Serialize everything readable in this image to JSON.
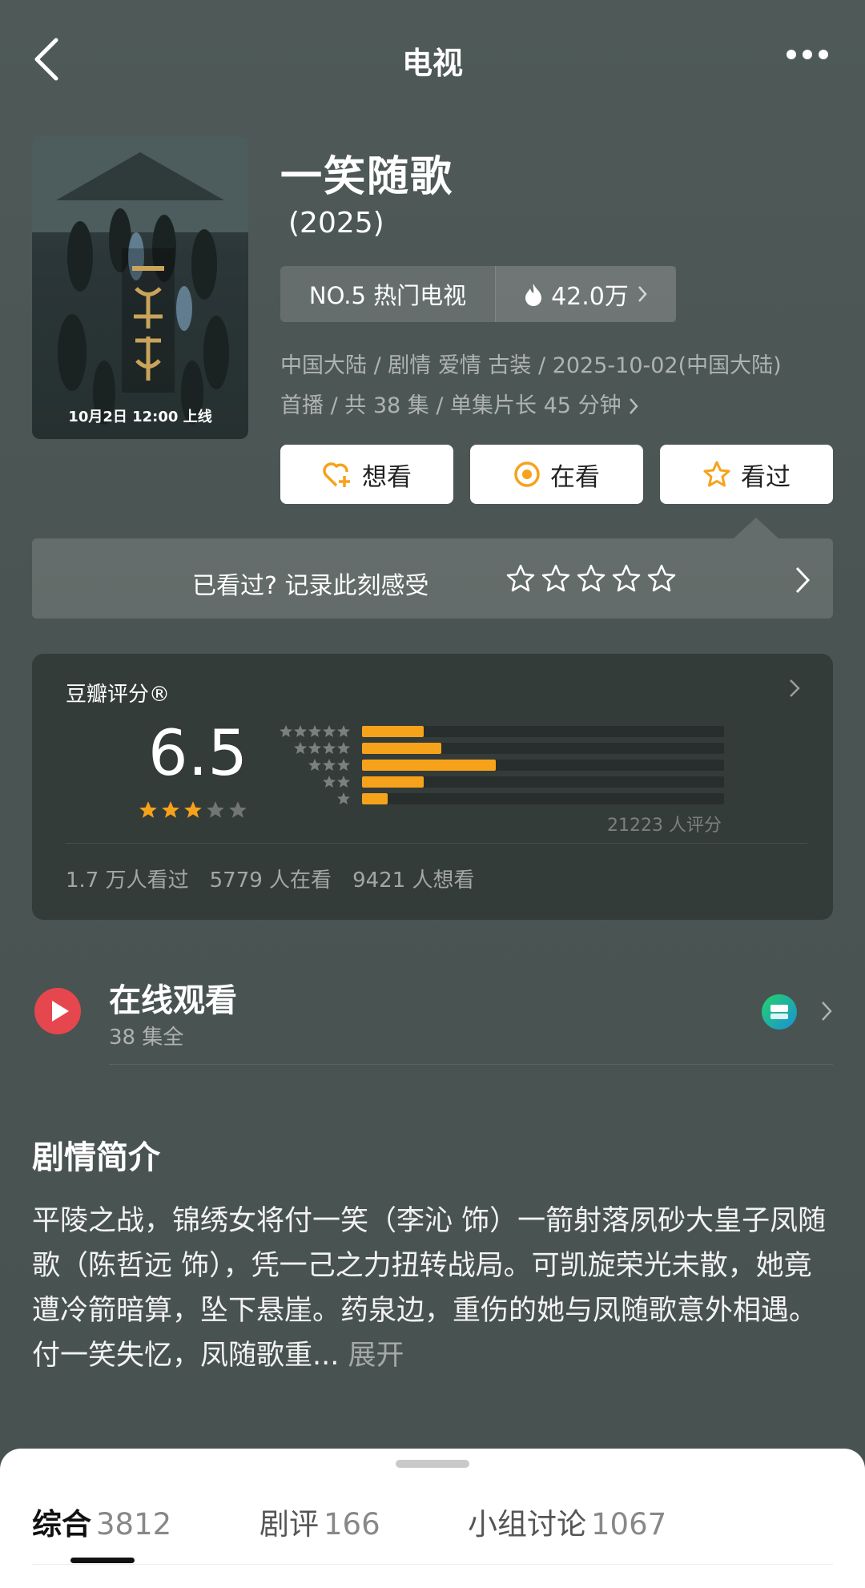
{
  "header": {
    "title": "电视"
  },
  "poster": {
    "caption": "10月2日 12:00 上线",
    "art_text": "一笑随歌"
  },
  "show": {
    "title": "一笑随歌",
    "year": "(2025)",
    "rank_label": "NO.5 热门电视",
    "heat": "42.0万",
    "meta_line1": "中国大陆 / 剧情 爱情 古装 / 2025-10-02(中国大陆)",
    "meta_line2": "首播 / 共 38 集 / 单集片长 45 分钟"
  },
  "actions": {
    "want": "想看",
    "watching": "在看",
    "watched": "看过"
  },
  "record": {
    "prompt": "已看过? 记录此刻感受",
    "star_count": 5
  },
  "rating": {
    "label": "豆瓣评分®",
    "score": "6.5",
    "stars_filled": 3,
    "stars_total": 5,
    "distribution_fraction": [
      0.17,
      0.22,
      0.37,
      0.17,
      0.07
    ],
    "count_text": "21223 人评分",
    "watched": "1.7 万人看过",
    "watching": "5779 人在看",
    "want": "9421 人想看"
  },
  "online": {
    "title": "在线观看",
    "subtitle": "38 集全",
    "provider_icon": "iqiyi-icon"
  },
  "synopsis": {
    "heading": "剧情简介",
    "text": "平陵之战，锦绣女将付一笑（李沁 饰）一箭射落夙砂大皇子凤随歌（陈哲远 饰），凭一己之力扭转战局。可凯旋荣光未散，她竟遭冷箭暗算，坠下悬崖。药泉边，重伤的她与凤随歌意外相遇。付一笑失忆，凤随歌重...",
    "expand": "展开"
  },
  "tabs": [
    {
      "label": "综合",
      "count": "3812",
      "active": true
    },
    {
      "label": "剧评",
      "count": "166",
      "active": false
    },
    {
      "label": "小组讨论",
      "count": "1067",
      "active": false
    }
  ],
  "colors": {
    "accent": "#f7a21b",
    "background": "#4a5553",
    "play": "#e6474f"
  }
}
